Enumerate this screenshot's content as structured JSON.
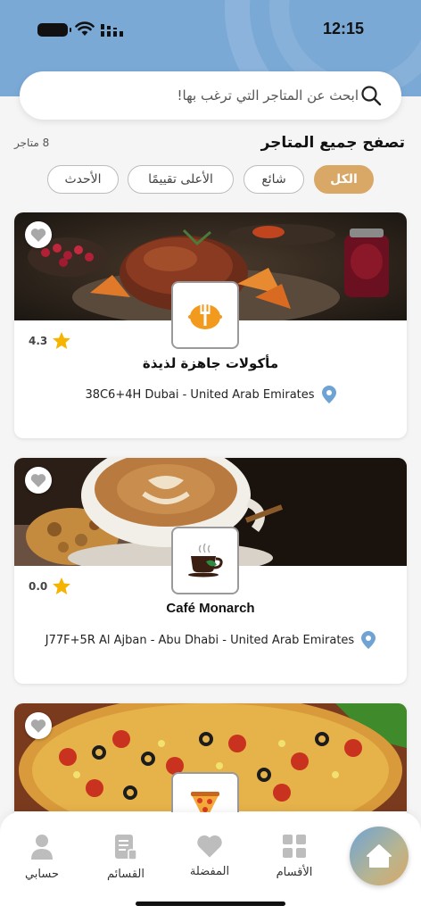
{
  "status_bar": {
    "time": "12:15"
  },
  "search": {
    "placeholder": "ابحث عن المتاجر التي ترغب بها!"
  },
  "section": {
    "title": "تصفح جميع المتاجر",
    "count": "8 متاجر"
  },
  "filters": [
    {
      "label": "الكل",
      "active": true
    },
    {
      "label": "شائع",
      "active": false
    },
    {
      "label": "الأعلى تقييمًا",
      "active": false
    },
    {
      "label": "الأحدث",
      "active": false
    }
  ],
  "stores": [
    {
      "name": "مأكولات جاهزة لذيذة",
      "rating": "4.3",
      "address": "38C6+4H Dubai - United Arab Emirates",
      "logo_icon": "fork-pot-icon"
    },
    {
      "name": "Café Monarch",
      "rating": "0.0",
      "address": "J77F+5R Al Ajban - Abu Dhabi - United Arab Emirates",
      "logo_icon": "coffee-cup-icon"
    },
    {
      "name": "",
      "rating": "",
      "address": "",
      "logo_icon": "pizza-slice-icon"
    }
  ],
  "bottom_nav": {
    "categories": "الأقسام",
    "favorites": "المفضلة",
    "lists": "القسائم",
    "account": "حسابي"
  },
  "colors": {
    "accent": "#d9a766",
    "header": "#7ba9d6",
    "star": "#f4b400",
    "pin": "#6fa3d4"
  }
}
